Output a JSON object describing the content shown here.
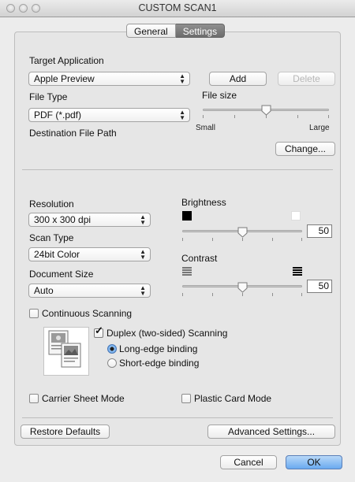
{
  "window": {
    "title": "CUSTOM SCAN1"
  },
  "tabs": [
    {
      "label": "General",
      "selected": false
    },
    {
      "label": "Settings",
      "selected": true
    }
  ],
  "target_application": {
    "label": "Target Application",
    "value": "Apple Preview",
    "add_label": "Add",
    "delete_label": "Delete"
  },
  "file_type": {
    "label": "File Type",
    "value": "PDF (*.pdf)"
  },
  "file_size": {
    "label": "File size",
    "small_label": "Small",
    "large_label": "Large",
    "level": 0.5
  },
  "destination": {
    "label": "Destination File Path",
    "change_label": "Change..."
  },
  "resolution": {
    "label": "Resolution",
    "value": "300 x 300 dpi"
  },
  "scan_type": {
    "label": "Scan Type",
    "value": "24bit Color"
  },
  "document_size": {
    "label": "Document Size",
    "value": "Auto"
  },
  "brightness": {
    "label": "Brightness",
    "value": "50"
  },
  "contrast": {
    "label": "Contrast",
    "value": "50"
  },
  "continuous": {
    "label": "Continuous Scanning",
    "checked": false
  },
  "duplex": {
    "label": "Duplex (two-sided) Scanning",
    "checked": true,
    "long_edge": {
      "label": "Long-edge binding",
      "selected": true
    },
    "short_edge": {
      "label": "Short-edge binding",
      "selected": false
    }
  },
  "carrier_sheet": {
    "label": "Carrier Sheet Mode",
    "checked": false
  },
  "plastic_card": {
    "label": "Plastic Card Mode",
    "checked": false
  },
  "footer": {
    "restore_label": "Restore Defaults",
    "advanced_label": "Advanced Settings...",
    "cancel_label": "Cancel",
    "ok_label": "OK"
  },
  "icons": {
    "check": "✓",
    "popup_arrows": "▲▼"
  },
  "colors": {
    "accent": "#6aaaf0",
    "selected_tab": "#7a7a7a"
  }
}
